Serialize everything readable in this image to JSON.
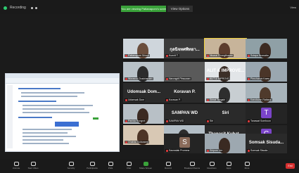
{
  "topbar": {
    "recording_label": "Recording",
    "share_banner": "You are viewing Pattanaporn's screen",
    "view_options": "View Options",
    "right_label": "View"
  },
  "tiles": [
    {
      "big": "",
      "caption": "Pattanaporn Srisuk"
    },
    {
      "big": "กุลนิจทศพิทยา...",
      "caption": "Kunnit T."
    },
    {
      "big": "",
      "caption": "Nisarat Phongthanee"
    },
    {
      "big": "",
      "caption": "Sutapa Bussaba"
    },
    {
      "big": "",
      "caption": "Worawut Chaicharoen"
    },
    {
      "big": "",
      "caption": "Narongrit Pinsuwan"
    },
    {
      "big": "ALIT & IMPROVE...",
      "caption": "ALIT & IMPROVE"
    },
    {
      "big": "",
      "caption": "Pimchanok Kaew"
    },
    {
      "big": "Udomsak Dom...",
      "caption": "Udomsak Dom"
    },
    {
      "big": "Koravan P.",
      "caption": "Koravan P."
    },
    {
      "big": "",
      "caption": "Sirirat Tangsiri"
    },
    {
      "big": "",
      "caption": "Kanokwan Rattana"
    },
    {
      "big": "",
      "caption": "Panida Rungrot"
    },
    {
      "big": "SAMPAN WD",
      "caption": "SAMPAN WD"
    },
    {
      "big": "Siri",
      "caption": "Siri"
    },
    {
      "big": "",
      "caption": "Tanawat Somboon",
      "avatar": "T",
      "avatar_color": "#7b44c9"
    },
    {
      "big": "",
      "caption": "Chalida Sukkasem"
    },
    {
      "big": "",
      "caption": "Wipada Chan"
    },
    {
      "big": "Thanasit Kuhat...",
      "caption": "Thanasit Kuhat"
    },
    {
      "big": "",
      "caption": "Chayanan Jaidee",
      "avatar": "C",
      "avatar_color": "#7b44c9"
    },
    {
      "big": "",
      "caption": "Saowalak Promma",
      "avatar": "S",
      "avatar_color": "#8a6b5a"
    },
    {
      "big": "",
      "caption": "Siriporn Noi"
    },
    {
      "big": "Somsak Sisuda...",
      "caption": "Somsak Sisuda"
    }
  ],
  "bottombar": {
    "items": [
      "Unmute",
      "Start Video",
      "Security",
      "Participants",
      "Polls",
      "Chat",
      "Share Screen",
      "Record",
      "Breakout Rooms",
      "Reactions",
      "Apps",
      "More"
    ],
    "end_label": "End"
  },
  "colors": {
    "accent_green": "#3aa23a",
    "end_red": "#d62f2f",
    "avatar_purple": "#7b44c9"
  }
}
